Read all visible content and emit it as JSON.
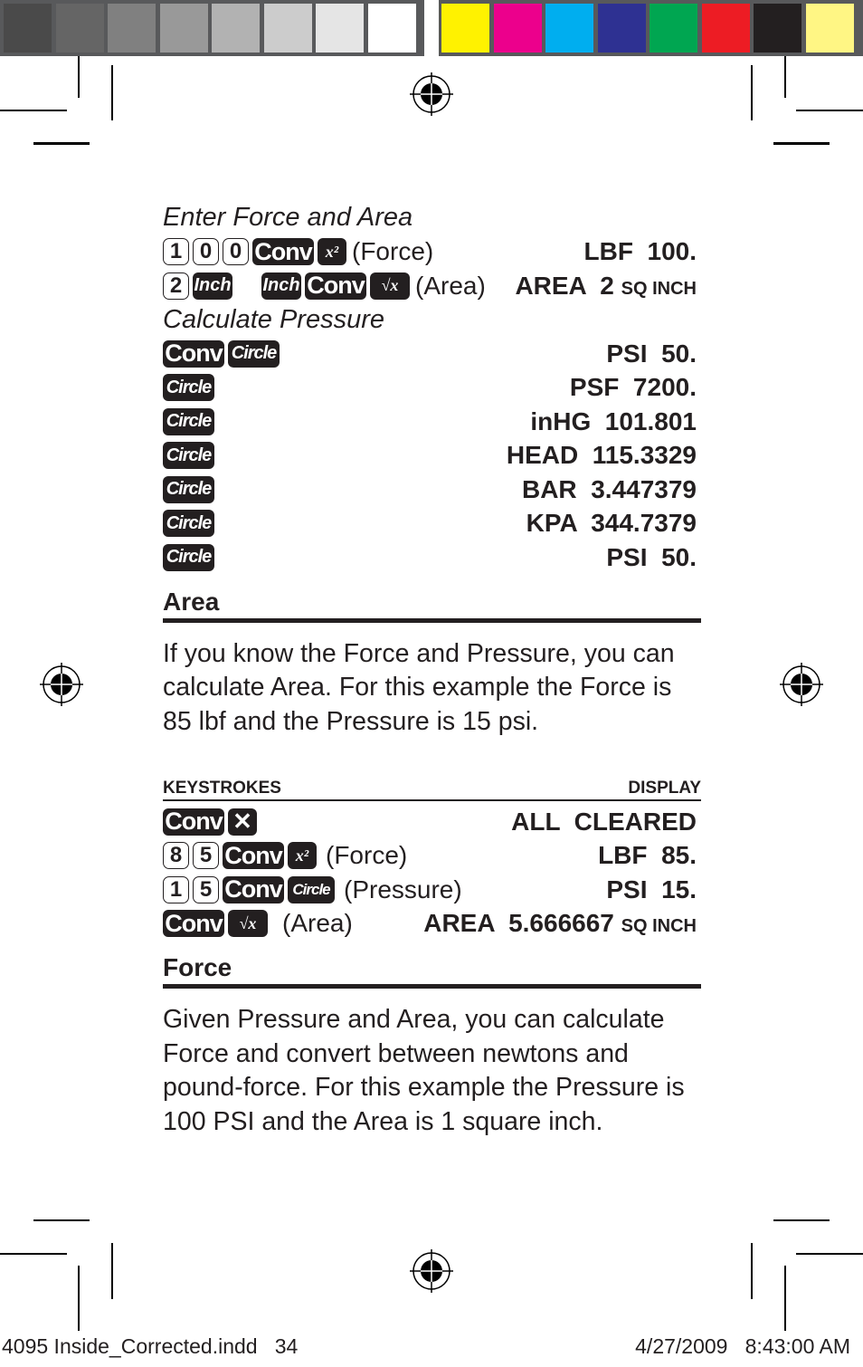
{
  "color_bar": {
    "grays": [
      "#4a4a4a",
      "#656565",
      "#808080",
      "#999999",
      "#b2b2b2",
      "#cccccc",
      "#e5e5e5",
      "#ffffff"
    ],
    "colors": [
      "#fff200",
      "#ec008c",
      "#00aeef",
      "#2e3192",
      "#00a651",
      "#ed1c24",
      "#231f20",
      "#fff684"
    ]
  },
  "pressure_example": {
    "enter_heading": "Enter Force and Area",
    "rows": [
      {
        "keys": [
          "1",
          "0",
          "0",
          "Conv",
          "x²"
        ],
        "label": "(Force)",
        "display": "LBF  100.",
        "unit": ""
      },
      {
        "keys": [
          "2",
          "Inch",
          "Inch",
          "Conv",
          "√x"
        ],
        "label": "(Area)",
        "display": "AREA  2",
        "unit": "SQ INCH"
      }
    ],
    "calc_heading": "Calculate Pressure",
    "calc_rows": [
      {
        "keys": [
          "Conv",
          "Circle"
        ],
        "display": "PSI  50."
      },
      {
        "keys": [
          "Circle"
        ],
        "display": "PSF  7200."
      },
      {
        "keys": [
          "Circle"
        ],
        "display": "inHG  101.801"
      },
      {
        "keys": [
          "Circle"
        ],
        "display": "HEAD  115.3329"
      },
      {
        "keys": [
          "Circle"
        ],
        "display": "BAR  3.447379"
      },
      {
        "keys": [
          "Circle"
        ],
        "display": "KPA  344.7379"
      },
      {
        "keys": [
          "Circle"
        ],
        "display": "PSI  50."
      }
    ]
  },
  "area_section": {
    "heading": "Area",
    "paragraph": "If you know the Force and Pressure, you can calculate Area. For this example the Force is 85 lbf and the Pressure is 15 psi.",
    "table_header": {
      "keystrokes": "KEYSTROKES",
      "display": "DISPLAY"
    },
    "rows": [
      {
        "keys": [
          "Conv",
          "✕"
        ],
        "label": "",
        "display": "ALL  CLEARED",
        "unit": ""
      },
      {
        "keys": [
          "8",
          "5",
          "Conv",
          "x²"
        ],
        "label": "(Force)",
        "display": "LBF  85.",
        "unit": ""
      },
      {
        "keys": [
          "1",
          "5",
          "Conv",
          "Circle"
        ],
        "label": "(Pressure)",
        "display": "PSI  15.",
        "unit": ""
      },
      {
        "keys": [
          "Conv",
          "√x"
        ],
        "label": "(Area)",
        "display": "AREA  5.666667",
        "unit": "SQ INCH"
      }
    ]
  },
  "force_section": {
    "heading": "Force",
    "paragraph": "Given Pressure and Area, you can calculate Force and convert between newtons and pound-force. For this example the Pressure is 100 PSI and the Area is 1 square inch."
  },
  "footer": {
    "file": "4095 Inside_Corrected.indd   34",
    "timestamp": "4/27/2009   8:43:00 AM"
  }
}
